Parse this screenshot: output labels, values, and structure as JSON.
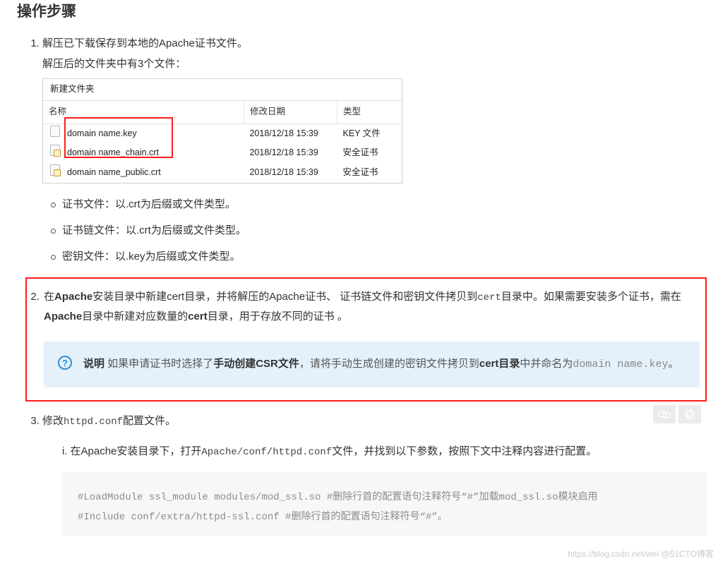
{
  "heading": "操作步骤",
  "step1": {
    "line1": "解压已下载保存到本地的Apache证书文件。",
    "line2": "解压后的文件夹中有3个文件：",
    "folder_bar": "新建文件夹",
    "cols": {
      "name": "名称",
      "date": "修改日期",
      "type": "类型"
    },
    "rows": [
      {
        "name": "domain name.key",
        "date": "2018/12/18 15:39",
        "type": "KEY 文件",
        "kind": "plain"
      },
      {
        "name": "domain name_chain.crt",
        "date": "2018/12/18 15:39",
        "type": "安全证书",
        "kind": "cert"
      },
      {
        "name": "domain name_public.crt",
        "date": "2018/12/18 15:39",
        "type": "安全证书",
        "kind": "cert"
      }
    ],
    "bullets": [
      "证书文件：以.crt为后缀或文件类型。",
      "证书链文件：以.crt为后缀或文件类型。",
      "密钥文件：以.key为后缀或文件类型。"
    ]
  },
  "step2": {
    "p_prefix": "在",
    "b1": "Apache",
    "p_mid1": "安装目录中新建cert目录，并将解压的Apache证书、 证书链文件和密钥文件拷贝到",
    "code1": "cert",
    "p_mid2": "目录中。如果需要安装多个证书，需在",
    "b2": "Apache",
    "p_mid3": "目录中新建对应数量的",
    "b3": "cert",
    "p_tail": "目录，用于存放不同的证书 。",
    "note": {
      "bold1": "说明",
      "text1": " 如果申请证书时选择了",
      "bold2": "手动创建CSR文件",
      "text2": "，请将手动生成创建的密钥文件拷贝到",
      "bold3": "cert目录",
      "text3": "中并命名为",
      "code": "domain name.key",
      "tail": "。"
    }
  },
  "step3": {
    "intro_prefix": "修改",
    "intro_code": "httpd.conf",
    "intro_suffix": "配置文件。",
    "sub_i": {
      "marker": "i.",
      "t1": "在Apache安装目录下，打开",
      "code1": "Apache/conf/httpd.conf",
      "t2": "文件，并找到以下参数，按照下文中注释内容进行配置。"
    },
    "code_lines": [
      "#LoadModule ssl_module modules/mod_ssl.so  #删除行首的配置语句注释符号“#”加载mod_ssl.so模块启用",
      "#Include conf/extra/httpd-ssl.conf  #删除行首的配置语句注释符号“#”。"
    ]
  },
  "watermark": "https://blog.csdn.net/wei   @51CTO博客"
}
